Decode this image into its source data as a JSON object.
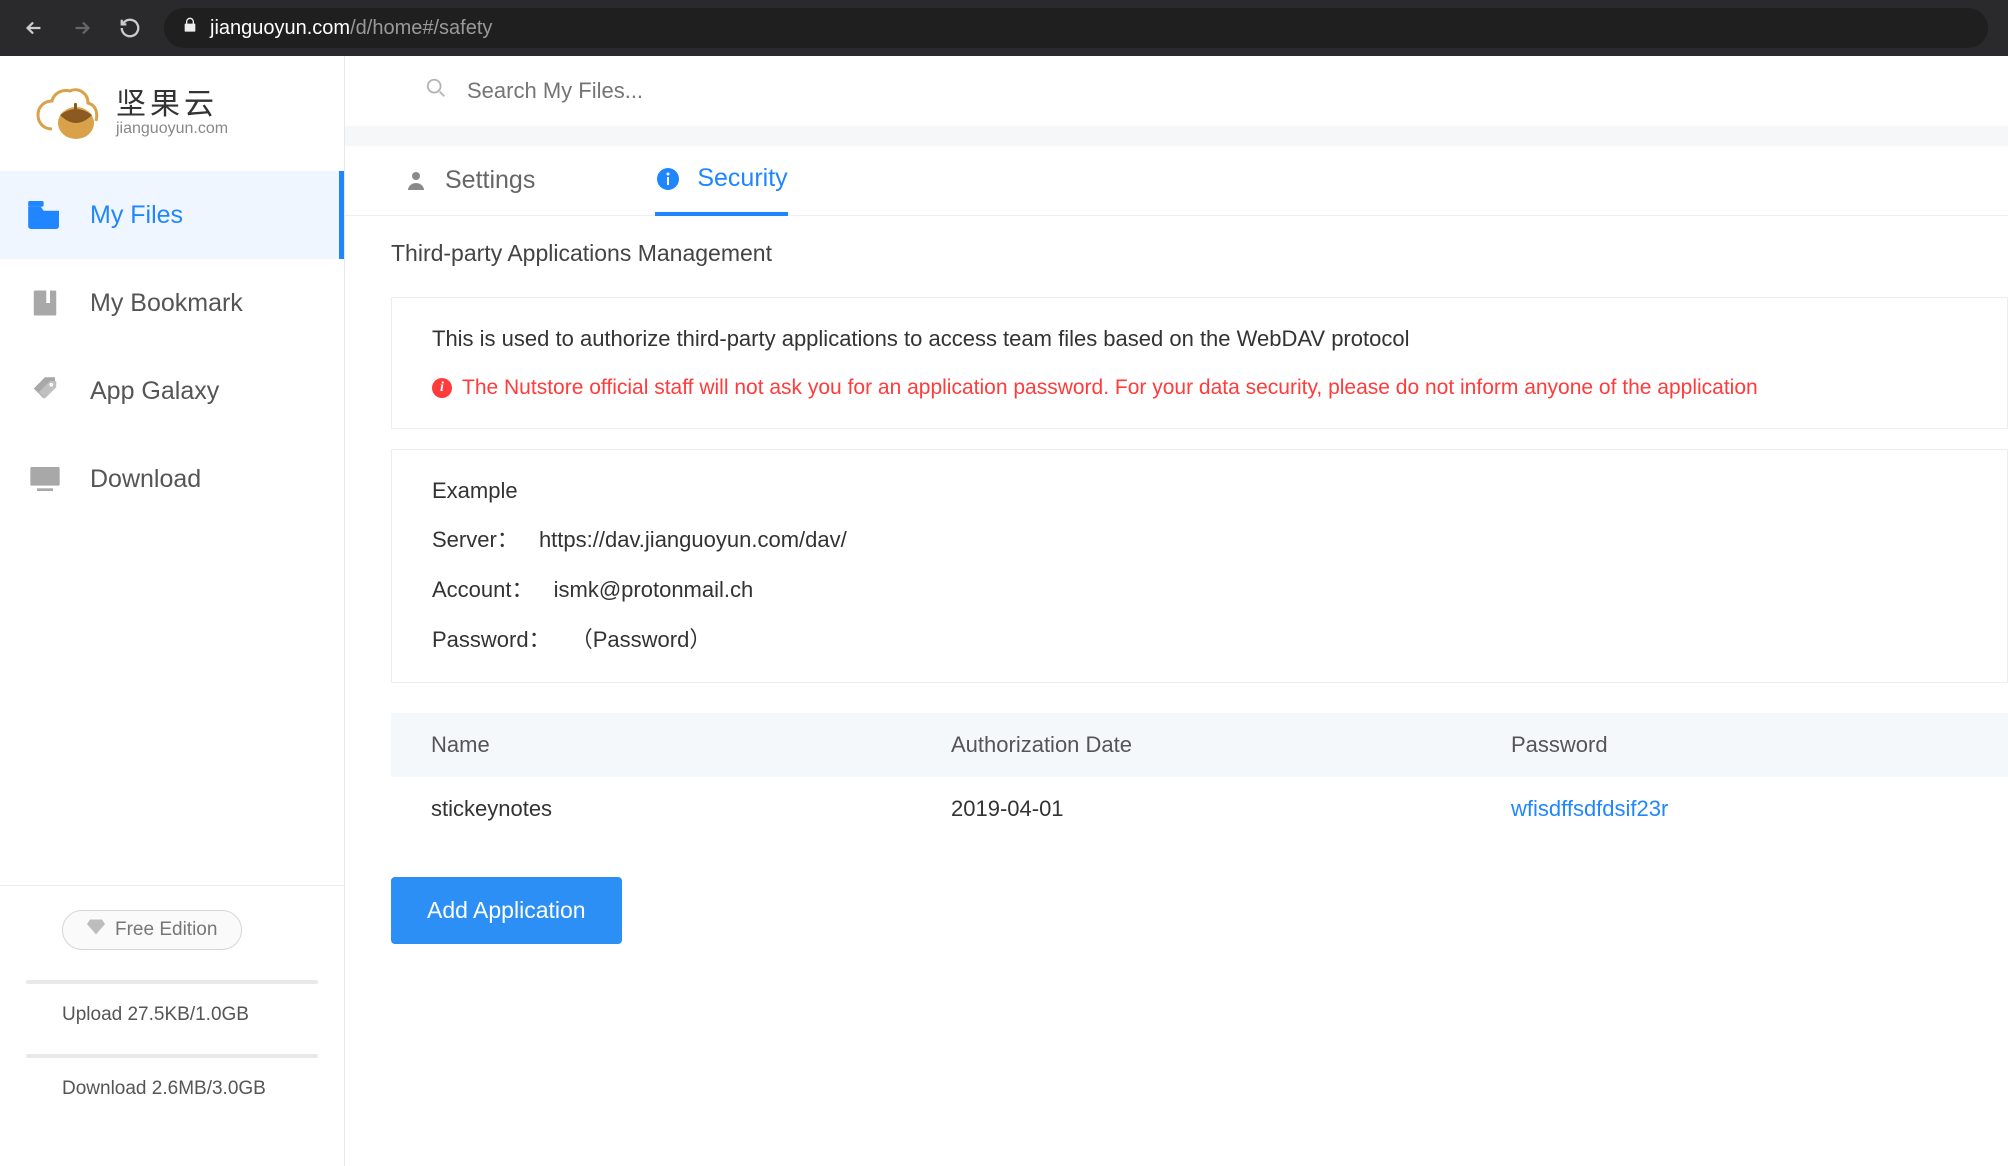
{
  "browser": {
    "url_domain": "jianguoyun.com",
    "url_path": "/d/home#/safety"
  },
  "logo": {
    "cn": "坚果云",
    "en": "jianguoyun.com"
  },
  "sidebar": {
    "items": [
      {
        "label": "My Files"
      },
      {
        "label": "My Bookmark"
      },
      {
        "label": "App Galaxy"
      },
      {
        "label": "Download"
      }
    ],
    "edition_label": "Free Edition",
    "upload_label": "Upload 27.5KB/1.0GB",
    "download_label": "Download 2.6MB/3.0GB"
  },
  "search": {
    "placeholder": "Search My Files..."
  },
  "tabs": {
    "settings": "Settings",
    "security": "Security"
  },
  "section": {
    "title": "Third-party Applications Management",
    "desc": "This is used to authorize third-party applications to access team files based on the WebDAV protocol",
    "warn": "The Nutstore official staff will not ask you for an application password. For your data security, please do not inform anyone of the application"
  },
  "example": {
    "title": "Example",
    "server_label": "Server：",
    "server_value": "https://dav.jianguoyun.com/dav/",
    "account_label": "Account：",
    "account_value": "ismk@protonmail.ch",
    "password_label": "Password：",
    "password_value": "（Password）"
  },
  "table": {
    "headers": {
      "name": "Name",
      "date": "Authorization Date",
      "pass": "Password"
    },
    "rows": [
      {
        "name": "stickeynotes",
        "date": "2019-04-01",
        "pass": "wfisdffsdfdsif23r"
      }
    ]
  },
  "buttons": {
    "add": "Add Application"
  }
}
